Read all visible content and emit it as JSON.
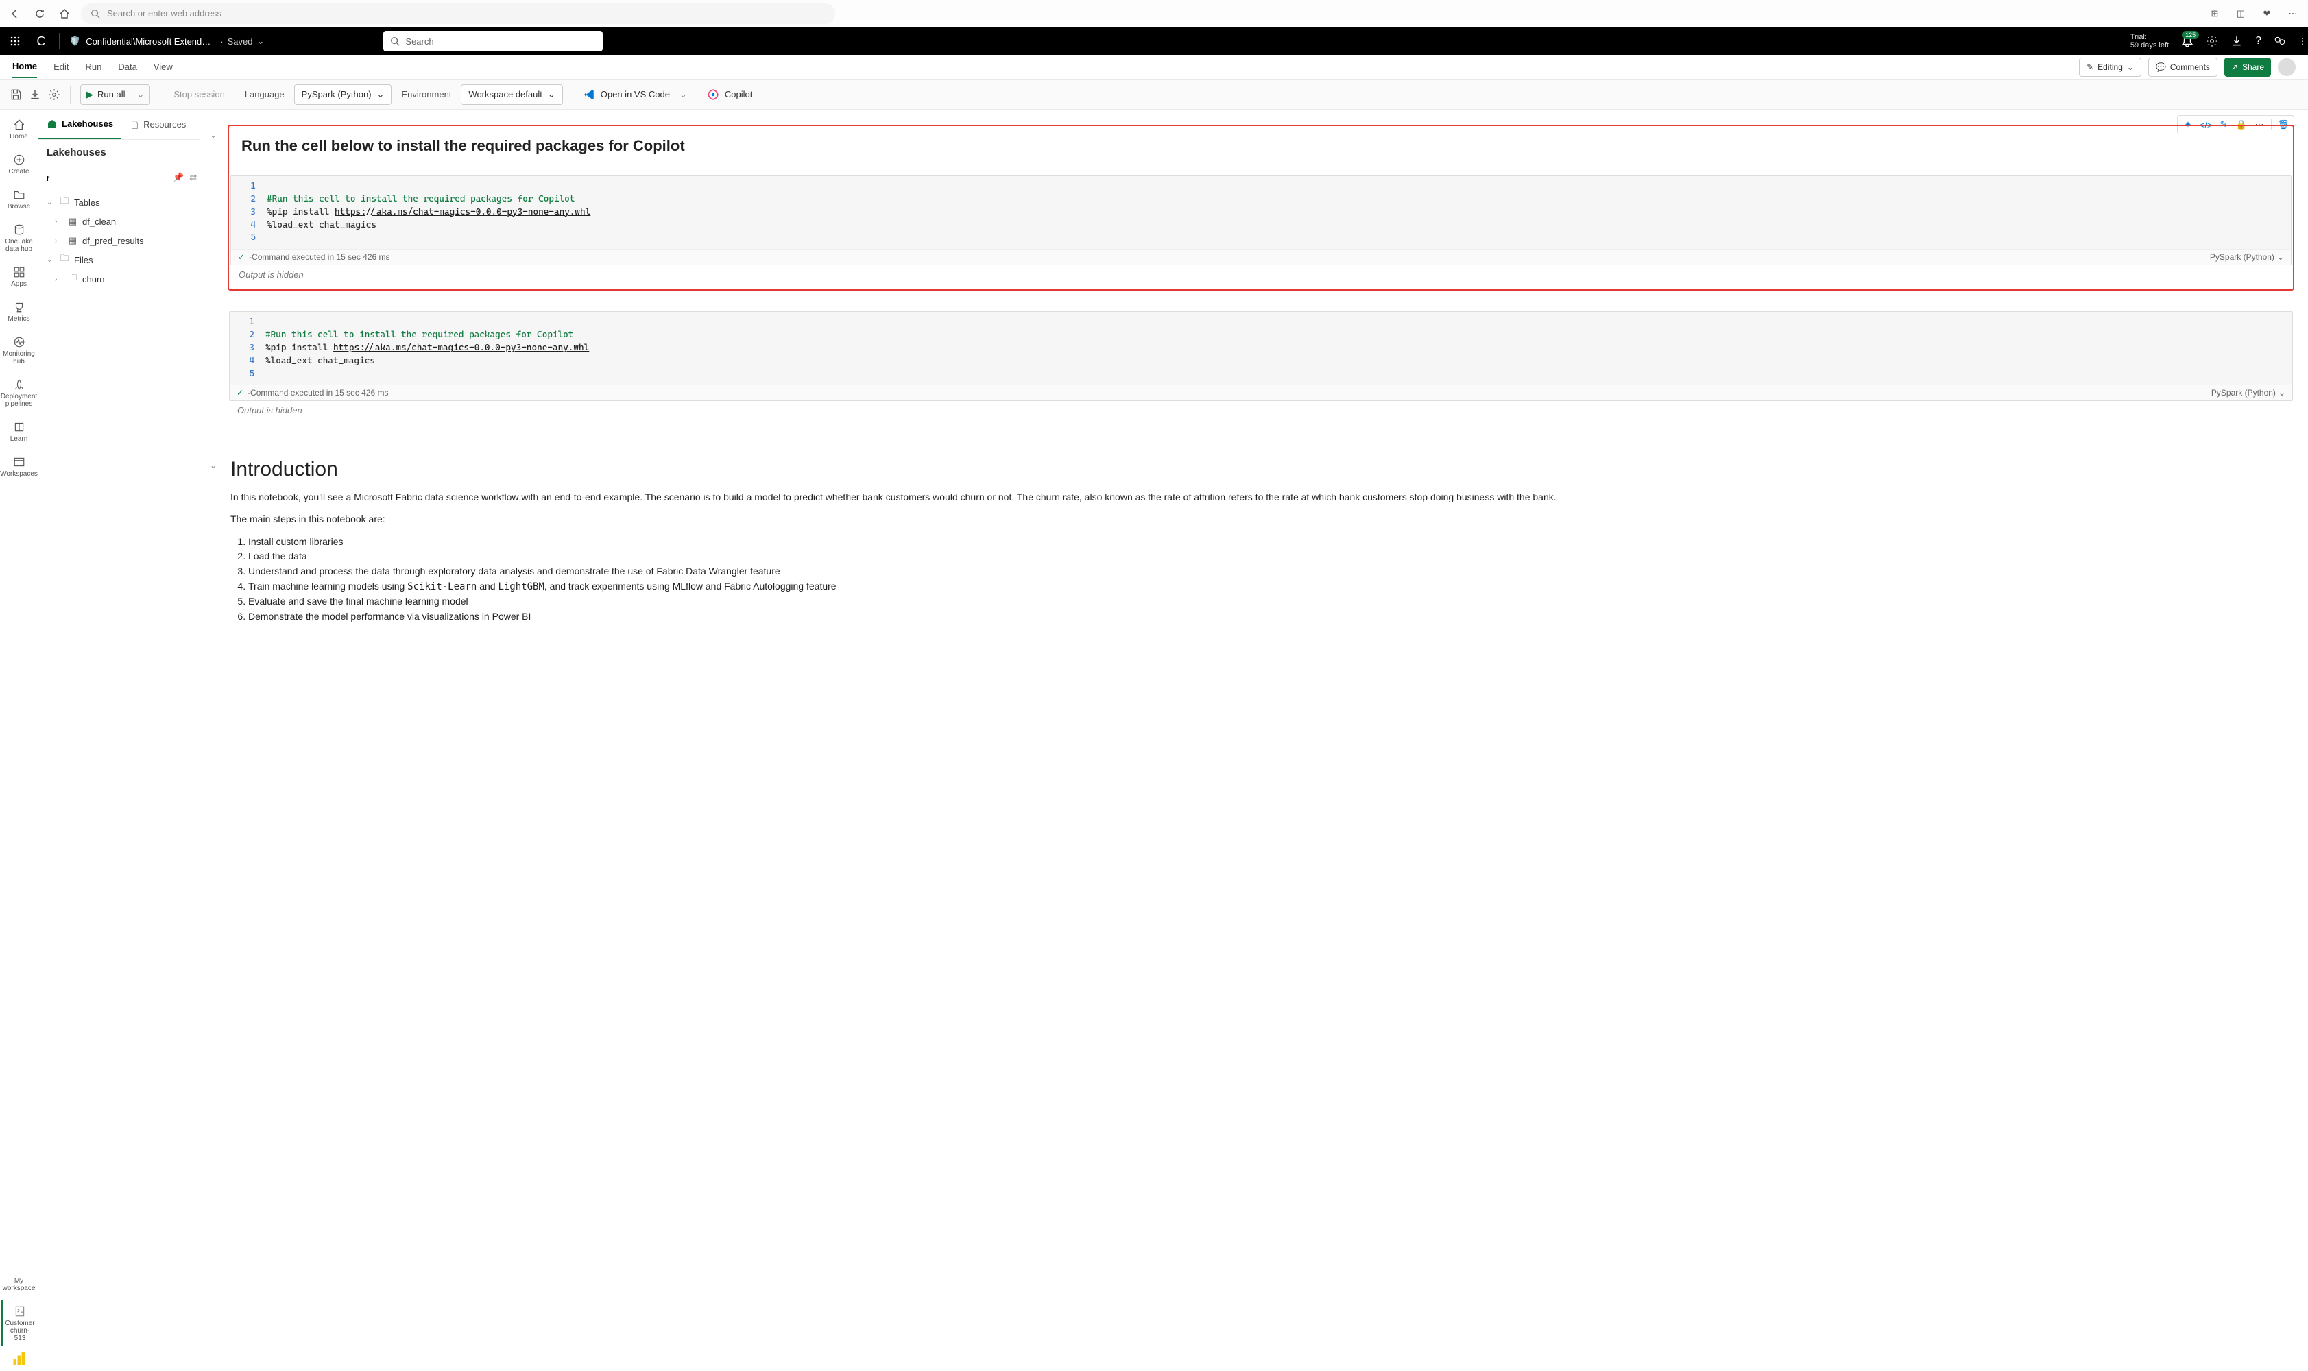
{
  "browser": {
    "url_placeholder": "Search or enter web address"
  },
  "topbar": {
    "workspace_letter": "C",
    "breadcrumb": "Confidential\\Microsoft Extend…",
    "saved": "Saved",
    "search_placeholder": "Search",
    "trial_label": "Trial:",
    "trial_days": "59 days left",
    "notif_count": "125"
  },
  "ribbon": {
    "tabs": [
      "Home",
      "Edit",
      "Run",
      "Data",
      "View"
    ],
    "editing": "Editing",
    "comments": "Comments",
    "share": "Share"
  },
  "toolbar": {
    "run_all": "Run all",
    "stop_session": "Stop session",
    "language_label": "Language",
    "language_value": "PySpark (Python)",
    "environment_label": "Environment",
    "environment_value": "Workspace default",
    "open_vscode": "Open in VS Code",
    "copilot": "Copilot"
  },
  "nav_rail": {
    "items": [
      "Home",
      "Create",
      "Browse",
      "OneLake data hub",
      "Apps",
      "Metrics",
      "Monitoring hub",
      "Deployment pipelines",
      "Learn",
      "Workspaces"
    ],
    "my_workspace": "My workspace",
    "notebook_name": "Customer churn-513"
  },
  "panel": {
    "tabs": [
      "Lakehouses",
      "Resources"
    ],
    "title": "Lakehouses",
    "search_value": "r",
    "tree": {
      "tables": "Tables",
      "t1": "df_clean",
      "t2": "df_pred_results",
      "files": "Files",
      "f1": "churn"
    }
  },
  "cell_toolbar": {
    "icons": [
      "sparkle",
      "code",
      "edit",
      "lock",
      "more",
      "delete"
    ]
  },
  "cell1": {
    "md_title": "Run the cell below to install the required packages for Copilot",
    "lines": {
      "l1": "",
      "l2": "#Run this cell to install the required packages for Copilot",
      "l3a": "%pip install ",
      "l3b": "https://aka.ms/chat-magics-0.0.0-py3-none-any.whl",
      "l4": "%load_ext chat_magics",
      "l5": ""
    },
    "status": "-Command executed in 15 sec 426 ms",
    "lang": "PySpark (Python)",
    "output_hidden": "Output is hidden"
  },
  "intro": {
    "heading": "Introduction",
    "p1": "In this notebook, you'll see a Microsoft Fabric data science workflow with an end-to-end example. The scenario is to build a model to predict whether bank customers would churn or not. The churn rate, also known as the rate of attrition refers to the rate at which bank customers stop doing business with the bank.",
    "p2": "The main steps in this notebook are:",
    "steps": {
      "s1": "Install custom libraries",
      "s2": "Load the data",
      "s3": "Understand and process the data through exploratory data analysis and demonstrate the use of Fabric Data Wrangler feature",
      "s4a": "Train machine learning models using ",
      "s4b": "Scikit-Learn",
      "s4c": " and ",
      "s4d": "LightGBM",
      "s4e": ", and track experiments using MLflow and Fabric Autologging feature",
      "s5": "Evaluate and save the final machine learning model",
      "s6": "Demonstrate the model performance via visualizations in Power BI"
    }
  }
}
